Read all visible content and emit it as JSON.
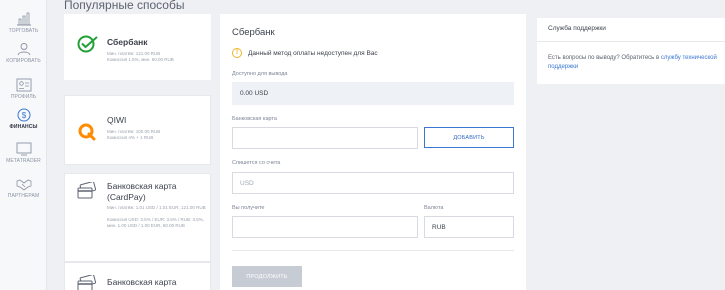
{
  "page": {
    "title": "Популярные способы"
  },
  "sidebar": {
    "items": [
      {
        "label": "ТОРГОВАТЬ",
        "icon": "chart-bars-icon",
        "active": false
      },
      {
        "label": "КОПИРОВАТЬ",
        "icon": "user-icon",
        "active": false
      },
      {
        "label": "ПРОФИЛЬ",
        "icon": "profile-card-icon",
        "active": false
      },
      {
        "label": "ФИНАНСЫ",
        "icon": "dollar-circle-icon",
        "active": true
      },
      {
        "label": "METATRADER",
        "icon": "monitor-icon",
        "active": false
      },
      {
        "label": "ПАРТНЕРАМ",
        "icon": "handshake-icon",
        "active": false
      }
    ]
  },
  "methods": [
    {
      "name": "Сбербанк",
      "desc1": "Мин. платёж: 121.00 RUB",
      "desc2": "Комиссия 1.5%, мин. 60.00 RUB",
      "icon": "sberbank-logo-icon"
    },
    {
      "name": "QIWI",
      "desc1": "Мин. платёж: 100.00 RUB",
      "desc2": "Комиссия 4% + 1 RUB",
      "icon": "qiwi-logo-icon"
    },
    {
      "name": "Банковская карта",
      "name2": "(CardPay)",
      "desc1": "Мин. платёж: 1.01 USD / 1.01 EUR, 121.00 RUB",
      "desc2": "Комиссия USD: 3.5% / EUR: 3.5% / RUB: 3.5%, мин. 1.00 USD / 1.00 EUR, 60.00 RUB",
      "icon": "bank-card-icon"
    },
    {
      "name": "Банковская карта",
      "icon": "bank-card-icon"
    }
  ],
  "form": {
    "title": "Сбербанк",
    "warning": "Данный метод оплаты недоступен для Вас",
    "available_label": "Доступно для вывода",
    "available_value": "0.00 USD",
    "card_label": "Банковская карта",
    "card_value": "",
    "add_button": "ДОБАВИТЬ",
    "debit_label": "Спишется со счета",
    "debit_placeholder": "USD",
    "receive_label": "Вы получите",
    "receive_value": "",
    "currency_label": "Валюта",
    "currency_value": "RUB",
    "continue_button": "ПРОДОЛЖИТЬ"
  },
  "support": {
    "title": "Служба поддержки",
    "text": "Есть вопросы по выводу? Обратитесь в ",
    "link": "службу технической поддержки"
  },
  "colors": {
    "accent": "#3a78d4",
    "sber_green": "#21a038",
    "qiwi_orange": "#ff8c00",
    "warning": "#f0b429"
  }
}
